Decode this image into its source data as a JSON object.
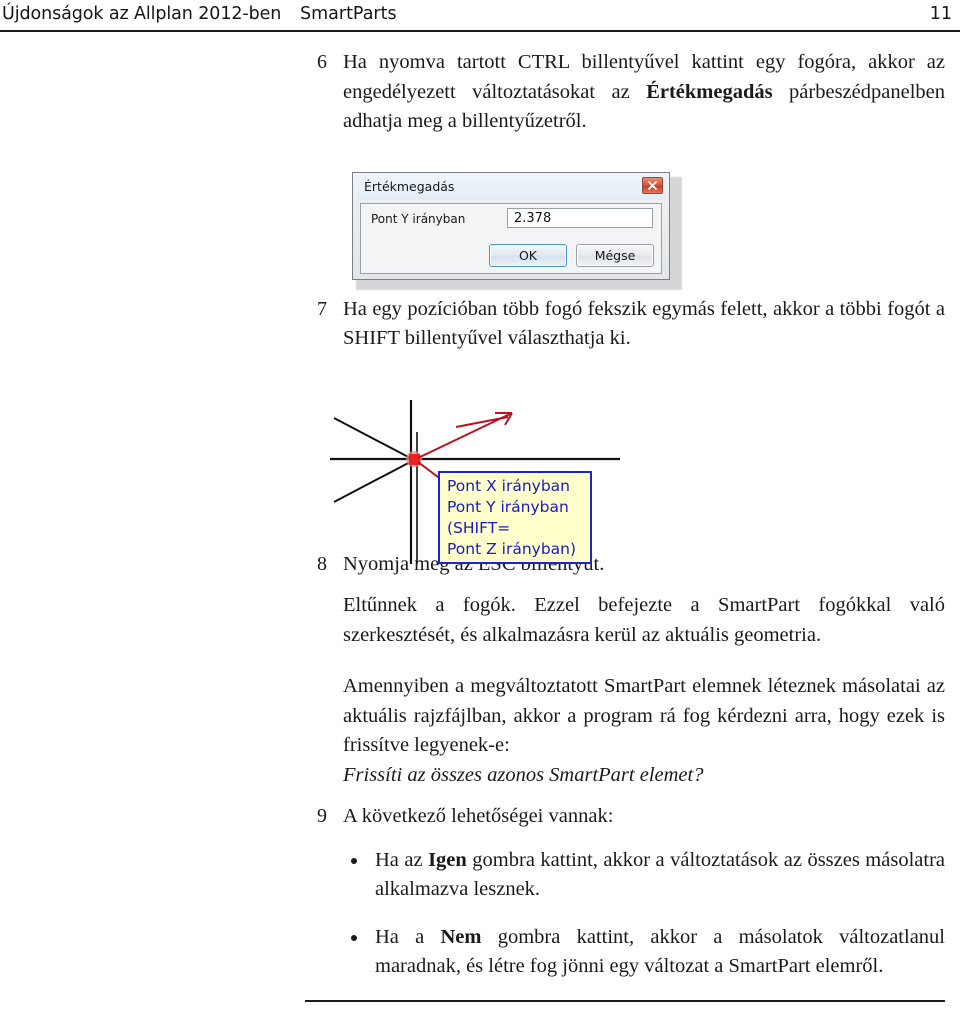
{
  "header": {
    "left_title": "Újdonságok az Allplan 2012-ben",
    "section": "SmartParts",
    "page_number": "11"
  },
  "steps": {
    "step6": {
      "number": "6",
      "text_part1": "Ha nyomva tartott CTRL billentyűvel kattint egy fogóra, akkor az engedélyezett változtatásokat az ",
      "emphasis": "Értékmegadás",
      "text_part2": " párbeszédpanelben adhatja meg a billentyűzetről."
    },
    "step7": {
      "number": "7",
      "text": "Ha egy pozícióban több fogó fekszik egymás felett, akkor a többi fogót a SHIFT billentyűvel választhatja ki."
    },
    "step8": {
      "number": "8",
      "text": "Nyomja meg az ESC billentyűt.",
      "para1": "Eltűnnek a fogók. Ezzel befejezte a SmartPart fogókkal való szerkesztését, és alkalmazásra kerül az aktuális geometria.",
      "para2": "Amennyiben a megváltoztatott SmartPart elemnek léteznek másolatai az aktuális rajzfájlban, akkor a program rá fog kérdezni arra, hogy ezek is frissítve legyenek-e:",
      "para3_italic": "Frissíti az összes azonos SmartPart elemet?"
    },
    "step9": {
      "number": "9",
      "text": "A következő lehetőségei vannak:",
      "bullets": [
        {
          "text_part1": "Ha az ",
          "emphasis": "Igen",
          "text_part2": " gombra kattint, akkor a változtatások az összes másolatra alkalmazva lesznek."
        },
        {
          "text_part1": "Ha a ",
          "emphasis": "Nem",
          "text_part2": " gombra kattint, akkor a másolatok változatlanul maradnak, és létre fog jönni egy változat a SmartPart elemről."
        }
      ]
    }
  },
  "dialog_figure": {
    "title": "Értékmegadás",
    "close_icon": "close-icon",
    "field_label": "Pont Y irányban",
    "field_value": "2.378",
    "ok_label": "OK",
    "cancel_label": "Mégse"
  },
  "crosshair_figure": {
    "tooltip_lines": [
      "Pont X irányban",
      "Pont Y irányban",
      "(SHIFT=",
      "Pont Z irányban)"
    ],
    "colors": {
      "tooltip_background": "#ffffcc",
      "tooltip_border": "#2222cc",
      "tooltip_text": "#1b1bbf",
      "arrow": "#bb1122",
      "handle_point": "#ee2222",
      "axis": "#000000"
    }
  }
}
